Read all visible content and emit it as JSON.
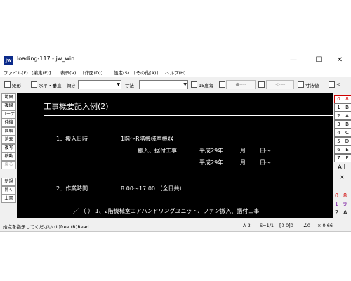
{
  "window": {
    "title": "loading-117 - jw_win",
    "icon_label": "jw",
    "minimize": "—",
    "maximize": "☐",
    "close": "✕"
  },
  "menu": [
    "ファイル(F)",
    "[編集(E)]",
    "表示(V)",
    "[作図(D)]",
    "設定(S)",
    "[その他(A)]",
    "ヘルプ(H)"
  ],
  "toolbar": {
    "rect": "矩形",
    "hv": "水平・垂直",
    "tilt": "傾き",
    "dim": "寸法",
    "deg15": "15度毎",
    "circle_field": "●----",
    "dash_field": "<----",
    "dimval": "寸法値",
    "lt": "<"
  },
  "left_tools": [
    "範囲",
    "複線",
    "コーナー",
    "伸縮",
    "面取",
    "消去",
    "複写",
    "移動",
    "戻る",
    "",
    "新規",
    "開く",
    "上書"
  ],
  "right_numbers": [
    "0",
    "8",
    "1",
    "2",
    "3",
    "4",
    "5",
    "6",
    "7"
  ],
  "right_letters": [
    "B",
    "A",
    "B",
    "C",
    "D",
    "E",
    "F"
  ],
  "right_controls": {
    "all": "All",
    "x": "✕",
    "circ0": "0",
    "circ8": "8",
    "circ1": "1",
    "circ9": "9",
    "circ2": "2",
    "circA": "A"
  },
  "drawing": {
    "heading": "工事概要記入例(2)",
    "line1_num": "1．搬入日時",
    "line1_desc": "1階～R階機械室機器",
    "line2_desc": "搬入、据付工事",
    "line2_year": "平成29年",
    "line2_month": "月",
    "line2_day": "日～",
    "line3_year": "平成29年",
    "line3_month": "月",
    "line3_day": "日～",
    "line4_num": "2．作業時間",
    "line4_desc": "8:00～17:00 （全日共）",
    "line5": "／ （ ） 1、2階機械室エアハンドリングユニット、ファン搬入、据付工事"
  },
  "status": {
    "message": "始点を指示してください (L)free (R)Read",
    "paper": "A-3",
    "scale": "S=1/1",
    "layer": "[0-0]0",
    "angle": "∠0",
    "zoom": "× 0.66"
  }
}
